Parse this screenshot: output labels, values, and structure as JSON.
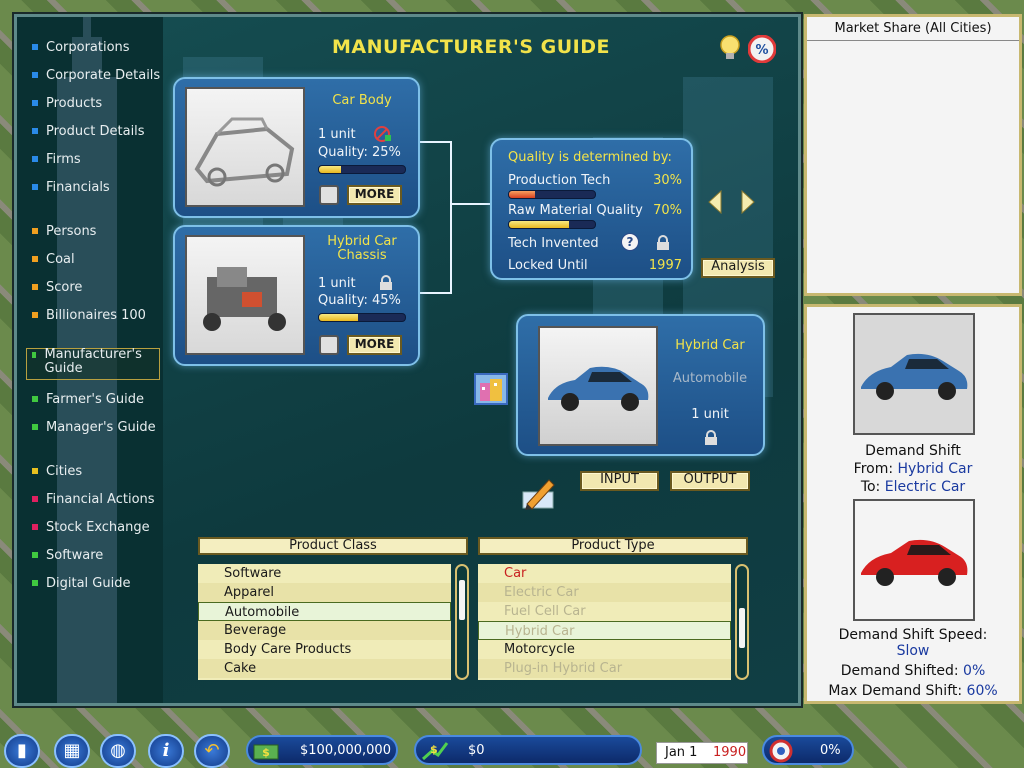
{
  "title": "MANUFACTURER'S GUIDE",
  "sidebar": {
    "groups": [
      [
        {
          "label": "Corporations",
          "color": "#2a8ae8"
        },
        {
          "label": "Corporate Details",
          "color": "#2a8ae8"
        },
        {
          "label": "Products",
          "color": "#2a8ae8"
        },
        {
          "label": "Product Details",
          "color": "#2a8ae8"
        },
        {
          "label": "Firms",
          "color": "#2a8ae8"
        },
        {
          "label": "Financials",
          "color": "#2a8ae8"
        }
      ],
      [
        {
          "label": "Persons",
          "color": "#f0a020"
        },
        {
          "label": "Coal",
          "color": "#f0a020"
        },
        {
          "label": "Score",
          "color": "#f0a020"
        },
        {
          "label": "Billionaires 100",
          "color": "#f0a020"
        }
      ],
      [
        {
          "label": "Manufacturer's Guide",
          "color": "#40c840"
        },
        {
          "label": "Farmer's Guide",
          "color": "#40c840"
        },
        {
          "label": "Manager's Guide",
          "color": "#40c840"
        }
      ],
      [
        {
          "label": "Cities",
          "color": "#e8c020"
        },
        {
          "label": "Financial Actions",
          "color": "#e02060"
        },
        {
          "label": "Stock Exchange",
          "color": "#e02060"
        },
        {
          "label": "Software",
          "color": "#40c840"
        },
        {
          "label": "Digital Guide",
          "color": "#40c840"
        }
      ]
    ]
  },
  "inputs": [
    {
      "name": "Car Body",
      "units": "1 unit",
      "quality_label": "Quality: 25%",
      "quality": 25,
      "more": "MORE"
    },
    {
      "name": "Hybrid Car Chassis",
      "units": "1 unit",
      "quality_label": "Quality: 45%",
      "quality": 45,
      "more": "MORE"
    }
  ],
  "quality_panel": {
    "heading": "Quality is determined by:",
    "rows": [
      {
        "label": "Production Tech",
        "value": "30%",
        "fill": 30
      },
      {
        "label": "Raw Material Quality",
        "value": "70%",
        "fill": 70
      }
    ],
    "tech_invented": "Tech Invented",
    "locked_until": "Locked Until",
    "locked_year": "1997"
  },
  "analysis_button": "Analysis",
  "output": {
    "name": "Hybrid Car",
    "category": "Automobile",
    "units": "1 unit"
  },
  "input_button": "INPUT",
  "output_button": "OUTPUT",
  "product_class": {
    "header": "Product Class",
    "items": [
      "Software",
      "Apparel",
      "Automobile",
      "Beverage",
      "Body Care Products",
      "Cake"
    ],
    "selected": 2
  },
  "product_type": {
    "header": "Product Type",
    "items": [
      {
        "label": "Car",
        "state": "red"
      },
      {
        "label": "Electric Car",
        "state": "dim"
      },
      {
        "label": "Fuel Cell Car",
        "state": "dim"
      },
      {
        "label": "Hybrid Car",
        "state": "dim-sel"
      },
      {
        "label": "Motorcycle",
        "state": "normal"
      },
      {
        "label": "Plug-in Hybrid Car",
        "state": "dim"
      }
    ]
  },
  "market_share": {
    "title": "Market Share (All Cities)"
  },
  "demand_panel": {
    "shift_label": "Demand Shift",
    "from_label": "From:",
    "from_value": "Hybrid Car",
    "to_label": "To:",
    "to_value": "Electric Car",
    "speed_label": "Demand Shift Speed:",
    "speed_value": "Slow",
    "shifted_label": "Demand Shifted:",
    "shifted_value": "0%",
    "max_label": "Max Demand Shift:",
    "max_value": "60%"
  },
  "taskbar": {
    "cash": "$100,000,000",
    "profit": "$0",
    "date_day": "Jan 1",
    "date_year": "1990",
    "rate": "0%"
  }
}
